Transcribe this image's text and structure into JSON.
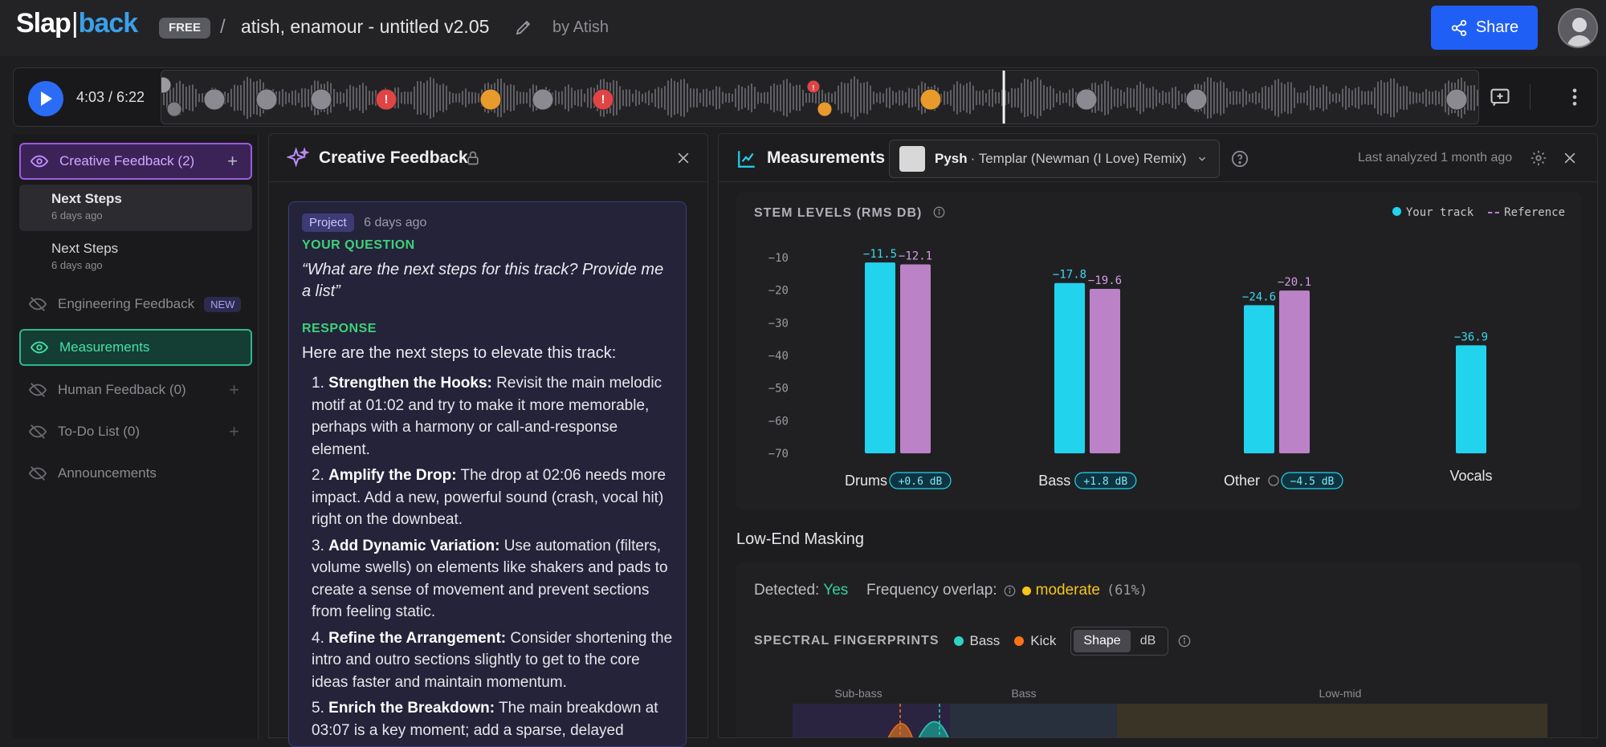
{
  "header": {
    "logo_a": "Slap",
    "logo_sep": "|",
    "logo_b": "back",
    "plan": "FREE",
    "separator": "/",
    "project_title": "atish, enamour - untitled v2.05",
    "byline": "by Atish",
    "share_label": "Share"
  },
  "player": {
    "time": "4:03 / 6:22",
    "played_fraction": 0.638
  },
  "sidebar": {
    "creative": {
      "label": "Creative Feedback (2)",
      "add": "+"
    },
    "entries": [
      {
        "title": "Next Steps",
        "date": "6 days ago"
      },
      {
        "title": "Next Steps",
        "date": "6 days ago"
      }
    ],
    "engineering": {
      "label": "Engineering Feedback",
      "badge": "NEW"
    },
    "measurements": {
      "label": "Measurements"
    },
    "human": {
      "label": "Human Feedback (0)",
      "add": "+"
    },
    "todo": {
      "label": "To-Do List (0)",
      "add": "+"
    },
    "announcements": {
      "label": "Announcements"
    }
  },
  "creative_panel": {
    "title": "Creative Feedback",
    "tag": "Project",
    "ago": "6 days ago",
    "question_label": "YOUR QUESTION",
    "question": "“What are the next steps for this track? Provide me a list”",
    "response_label": "RESPONSE",
    "intro": "Here are the next steps to elevate this track:",
    "steps": [
      {
        "num": "1.",
        "title": "Strengthen the Hooks:",
        "text": "Revisit the main melodic motif at 01:02 and try to make it more memorable, perhaps with a harmony or call-and-response element."
      },
      {
        "num": "2.",
        "title": "Amplify the Drop:",
        "text": "The drop at 02:06 needs more impact. Add a new, powerful sound (crash, vocal hit) right on the downbeat."
      },
      {
        "num": "3.",
        "title": "Add Dynamic Variation:",
        "text": "Use automation (filters, volume swells) on elements like shakers and pads to create a sense of movement and prevent sections from feeling static."
      },
      {
        "num": "4.",
        "title": "Refine the Arrangement:",
        "text": "Consider shortening the intro and outro sections slightly to get to the core ideas faster and maintain momentum."
      },
      {
        "num": "5.",
        "title": "Enrich the Breakdown:",
        "text": "The main breakdown at 03:07 is a key moment; add a sparse, delayed"
      }
    ]
  },
  "measurements_panel": {
    "title": "Measurements",
    "ref_artist": "Pysh",
    "ref_track": "· Templar (Newman (I Love) Remix)",
    "last_analyzed": "Last analyzed 1 month ago",
    "stem_title": "STEM LEVELS (RMS DB)",
    "legend_track": "Your track",
    "legend_ref": "Reference",
    "low_end_title": "Low-End Masking",
    "detected_label": "Detected:",
    "detected_value": "Yes",
    "overlap_label": "Frequency overlap:",
    "overlap_value": "moderate",
    "overlap_pct": "(61%)",
    "spectral_label": "SPECTRAL FINGERPRINTS",
    "legend_bass": "Bass",
    "legend_kick": "Kick",
    "toggle_shape": "Shape",
    "toggle_db": "dB",
    "bands": [
      "Sub-bass",
      "Bass",
      "Low-mid"
    ]
  },
  "colors": {
    "your_track": "#22d3ee",
    "reference": "#c98bd6",
    "bass": "#2dd4bf",
    "kick": "#f97316",
    "accent": "#1f5ff5"
  },
  "chart_data": {
    "type": "bar",
    "title": "STEM LEVELS (RMS DB)",
    "categories": [
      "Drums",
      "Bass",
      "Other",
      "Vocals"
    ],
    "series": [
      {
        "name": "Your track",
        "values": [
          -11.5,
          -17.8,
          -24.6,
          -36.9
        ]
      },
      {
        "name": "Reference",
        "values": [
          -12.1,
          -19.6,
          -20.1,
          null
        ]
      }
    ],
    "value_labels": {
      "Your track": [
        "−11.5",
        "−17.8",
        "−24.6",
        "−36.9"
      ],
      "Reference": [
        "−12.1",
        "−19.6",
        "−20.1",
        ""
      ]
    },
    "deltas": [
      "+0.6 dB",
      "+1.8 dB",
      "−4.5 dB",
      ""
    ],
    "yticks": [
      -10,
      -20,
      -30,
      -40,
      -50,
      -60,
      -70
    ],
    "ytick_labels": [
      "−10",
      "−20",
      "−30",
      "−40",
      "−50",
      "−60",
      "−70"
    ],
    "ylim": [
      -70,
      -10
    ],
    "xlabel": "",
    "ylabel": ""
  }
}
